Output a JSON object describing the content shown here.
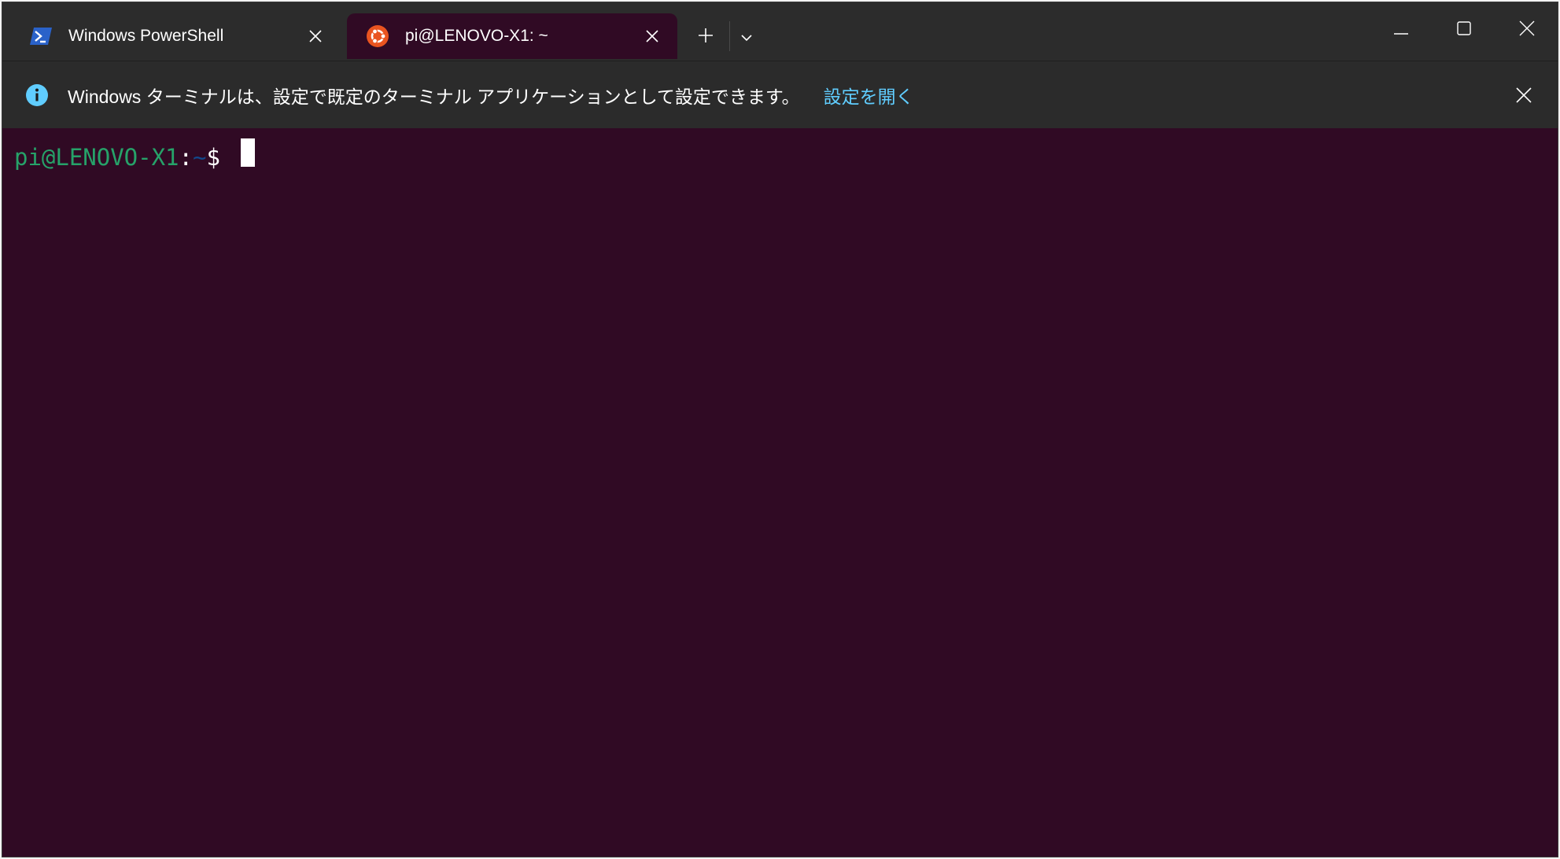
{
  "window": {
    "tabs": [
      {
        "title": "Windows PowerShell",
        "icon": "powershell-icon",
        "active": false
      },
      {
        "title": "pi@LENOVO-X1: ~",
        "icon": "ubuntu-icon",
        "active": true
      }
    ]
  },
  "infobar": {
    "message": "Windows ターミナルは、設定で既定のターミナル アプリケーションとして設定できます。",
    "link_label": "設定を開く",
    "icon": "info-icon"
  },
  "terminal": {
    "prompt_user_host": "pi@LENOVO-X1",
    "prompt_colon": ":",
    "prompt_path": "~",
    "prompt_symbol": "$",
    "colors": {
      "background": "#300a24",
      "user_host": "#26a269",
      "path": "#12488b",
      "text": "#ffffff"
    }
  },
  "colors": {
    "titlebar": "#2c2c2c",
    "link": "#60cdff",
    "ubuntu_orange": "#e95420",
    "powershell_blue": "#2a62c9"
  }
}
